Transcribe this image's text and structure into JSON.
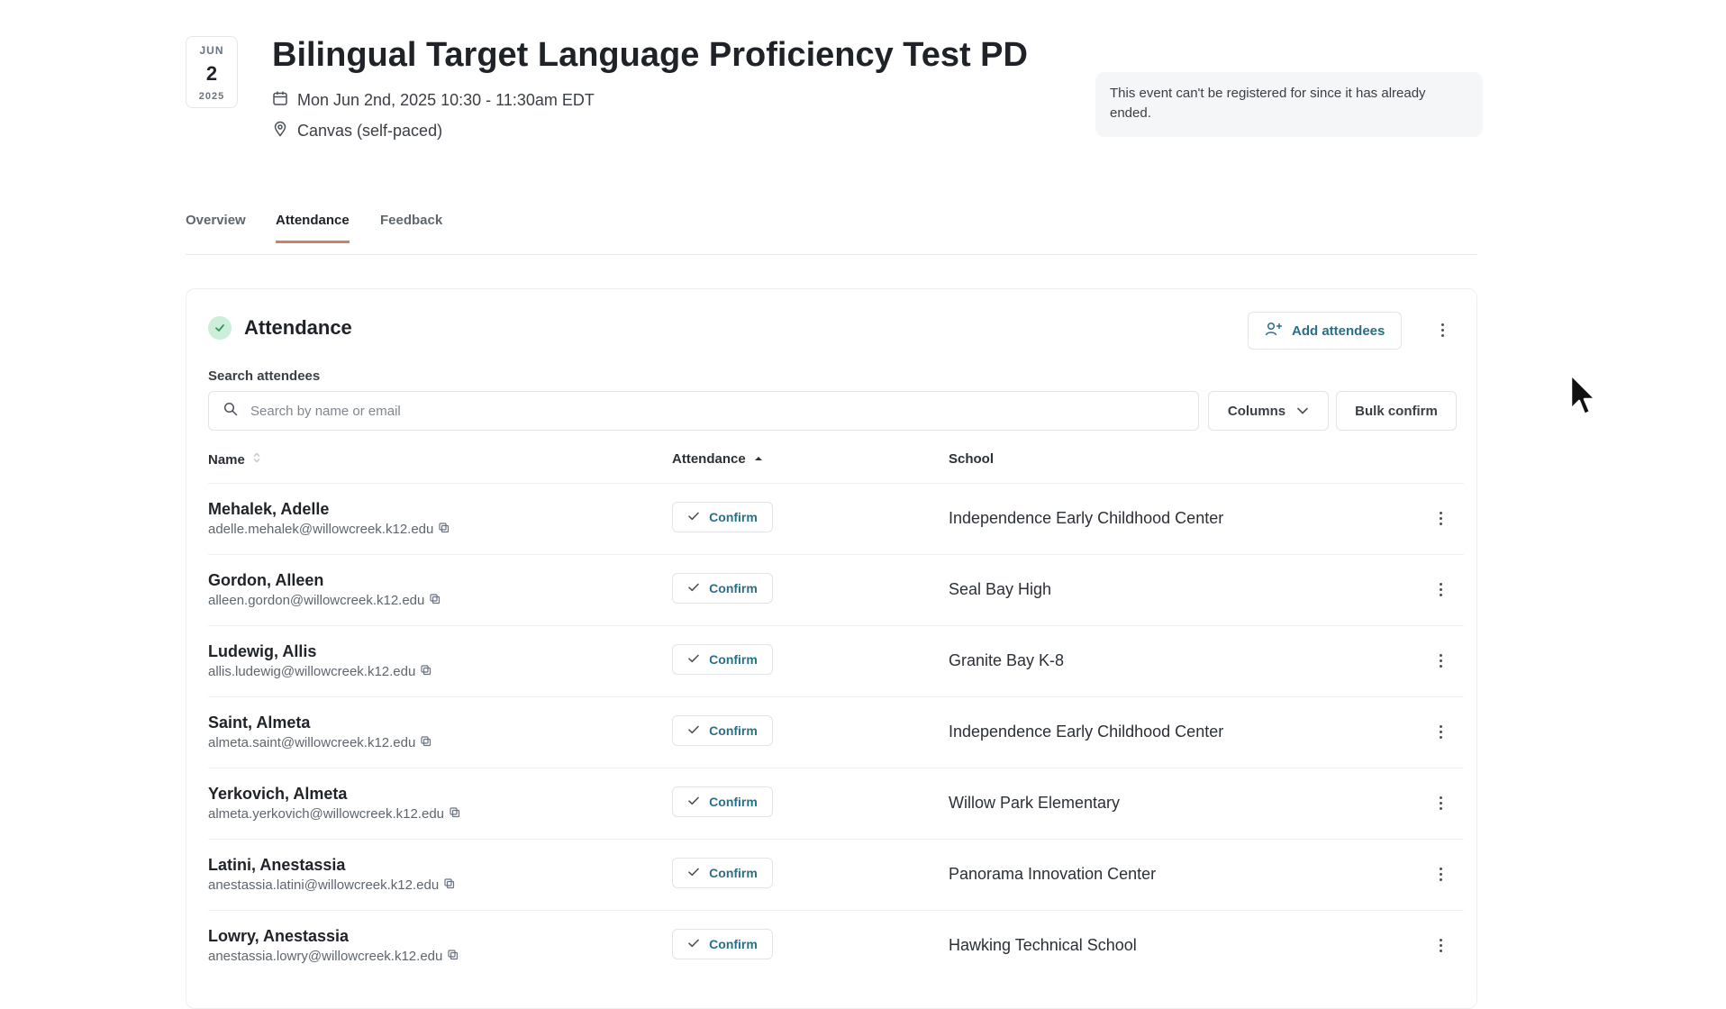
{
  "event": {
    "date_month": "JUN",
    "date_day": "2",
    "date_year": "2025",
    "title": "Bilingual Target Language Proficiency Test PD",
    "datetime": "Mon Jun 2nd, 2025 10:30 - 11:30am EDT",
    "location": "Canvas (self-paced)",
    "notice": "This event can't be registered for since it has already ended."
  },
  "tabs": [
    {
      "label": "Overview",
      "active": false
    },
    {
      "label": "Attendance",
      "active": true
    },
    {
      "label": "Feedback",
      "active": false
    }
  ],
  "attendance": {
    "title": "Attendance",
    "add_button": "Add attendees",
    "search_label": "Search attendees",
    "search_placeholder": "Search by name or email",
    "columns_button": "Columns",
    "bulk_button": "Bulk confirm",
    "headers": {
      "name": "Name",
      "attendance": "Attendance",
      "school": "School"
    },
    "rows": [
      {
        "name": "Mehalek, Adelle",
        "email": "adelle.mehalek@willowcreek.k12.edu",
        "action": "Confirm",
        "school": "Independence Early Childhood Center"
      },
      {
        "name": "Gordon, Alleen",
        "email": "alleen.gordon@willowcreek.k12.edu",
        "action": "Confirm",
        "school": "Seal Bay High"
      },
      {
        "name": "Ludewig, Allis",
        "email": "allis.ludewig@willowcreek.k12.edu",
        "action": "Confirm",
        "school": "Granite Bay K-8"
      },
      {
        "name": "Saint, Almeta",
        "email": "almeta.saint@willowcreek.k12.edu",
        "action": "Confirm",
        "school": "Independence Early Childhood Center"
      },
      {
        "name": "Yerkovich, Almeta",
        "email": "almeta.yerkovich@willowcreek.k12.edu",
        "action": "Confirm",
        "school": "Willow Park Elementary"
      },
      {
        "name": "Latini, Anestassia",
        "email": "anestassia.latini@willowcreek.k12.edu",
        "action": "Confirm",
        "school": "Panorama Innovation Center"
      },
      {
        "name": "Lowry, Anestassia",
        "email": "anestassia.lowry@willowcreek.k12.edu",
        "action": "Confirm",
        "school": "Hawking Technical School"
      }
    ]
  },
  "colors": {
    "accent": "#c9826b",
    "link": "#2a6f8a",
    "success_bg": "#cdeed9",
    "success": "#2f9a5b"
  },
  "icons": [
    "calendar-icon",
    "location-pin-icon",
    "check-icon",
    "user-plus-icon",
    "more-vertical-icon",
    "search-icon",
    "chevron-down-icon",
    "sort-icon",
    "sort-up-icon",
    "copy-icon",
    "cursor-icon"
  ]
}
